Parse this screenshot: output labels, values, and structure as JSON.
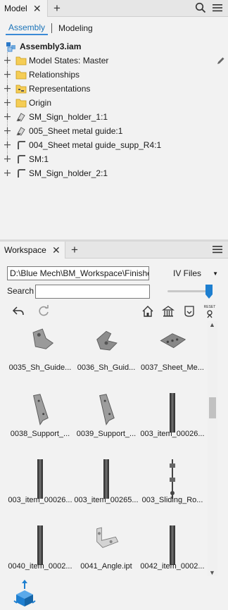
{
  "model_panel": {
    "tab_label": "Model",
    "subtabs": [
      "Assembly",
      "Modeling"
    ],
    "root": "Assembly3.iam",
    "tree": [
      {
        "label": "Model States: Master",
        "icon": "folder-icon"
      },
      {
        "label": "Relationships",
        "icon": "folder-icon"
      },
      {
        "label": "Representations",
        "icon": "representations-folder-icon"
      },
      {
        "label": "Origin",
        "icon": "folder-icon"
      },
      {
        "label": "SM_Sign_holder_1:1",
        "icon": "grounded-part-icon"
      },
      {
        "label": "005_Sheet metal guide:1",
        "icon": "grounded-part-icon"
      },
      {
        "label": "004_Sheet metal guide_supp_R4:1",
        "icon": "sheet-metal-part-icon"
      },
      {
        "label": "SM:1",
        "icon": "sheet-metal-part-icon"
      },
      {
        "label": "SM_Sign_holder_2:1",
        "icon": "sheet-metal-part-icon"
      }
    ]
  },
  "workspace_panel": {
    "tab_label": "Workspace",
    "path": "D:\\Blue Mech\\BM_Workspace\\Finished\\",
    "filter": "IV Files",
    "search_label": "Search",
    "search_value": "",
    "slider_level": 1.0,
    "files": [
      {
        "name": "0035_Sh_Guide...",
        "thumb": "bracket"
      },
      {
        "name": "0036_Sh_Guid...",
        "thumb": "bracket2"
      },
      {
        "name": "0037_Sheet_Me...",
        "thumb": "plate"
      },
      {
        "name": "0038_Support_...",
        "thumb": "support"
      },
      {
        "name": "0039_Support_...",
        "thumb": "support"
      },
      {
        "name": "003_item_00026...",
        "thumb": "profile"
      },
      {
        "name": "003_item_00026...",
        "thumb": "profile"
      },
      {
        "name": "003_item_00265...",
        "thumb": "profile"
      },
      {
        "name": "003_Sliding_Ro...",
        "thumb": "rod"
      },
      {
        "name": "0040_item_0002...",
        "thumb": "profile"
      },
      {
        "name": "0041_Angle.ipt",
        "thumb": "angle"
      },
      {
        "name": "0042_item_0002...",
        "thumb": "profile"
      }
    ]
  },
  "colors": {
    "accent": "#1a73b8",
    "folder": "#f3c84a",
    "viewcube": "#1e7fd0"
  }
}
